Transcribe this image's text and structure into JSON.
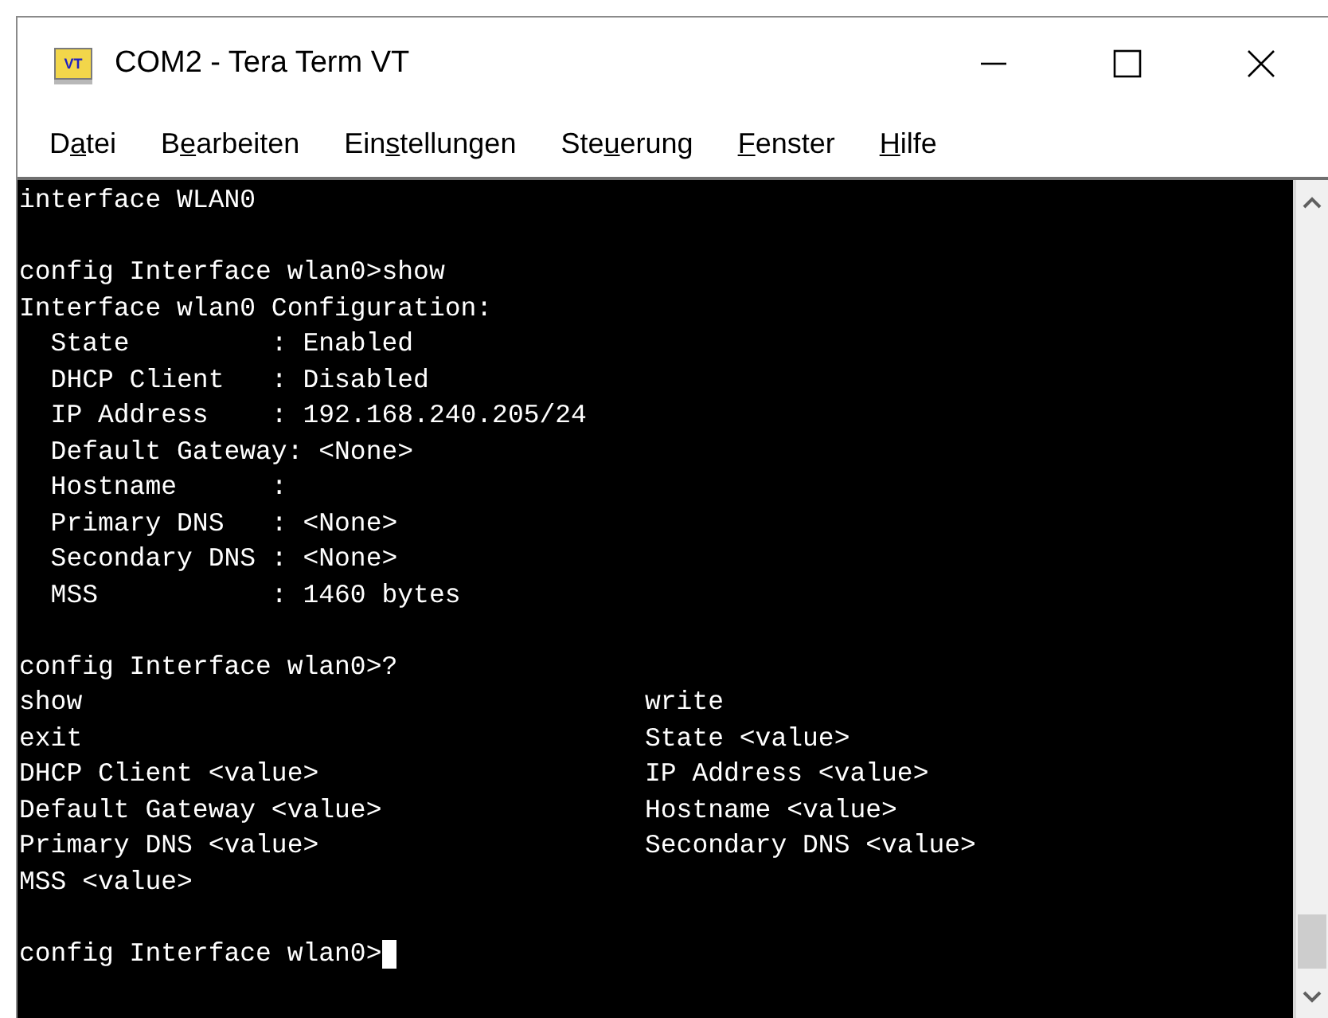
{
  "window": {
    "title": "COM2 - Tera Term VT",
    "app_icon_text": "VT"
  },
  "menu": [
    {
      "pre": "D",
      "key": "a",
      "post": "tei"
    },
    {
      "pre": "B",
      "key": "e",
      "post": "arbeiten"
    },
    {
      "pre": "Ein",
      "key": "s",
      "post": "tellungen"
    },
    {
      "pre": "Ste",
      "key": "u",
      "post": "erung"
    },
    {
      "key": "F",
      "post": "enster"
    },
    {
      "key": "H",
      "post": "ilfe"
    }
  ],
  "terminal": {
    "blocks": [
      [
        {
          "text": "interface WLAN0"
        }
      ],
      [
        {
          "text": "config Interface wlan0>show"
        },
        {
          "text": "Interface wlan0 Configuration:"
        },
        {
          "text": "  State         : Enabled"
        },
        {
          "text": "  DHCP Client   : Disabled"
        },
        {
          "text": "  IP Address    : 192.168.240.205/24"
        },
        {
          "text": "  Default Gateway: <None>"
        },
        {
          "text": "  Hostname      :"
        },
        {
          "text": "  Primary DNS   : <None>"
        },
        {
          "text": "  Secondary DNS : <None>"
        },
        {
          "text": "  MSS           : 1460 bytes"
        }
      ],
      [
        {
          "text": "config Interface wlan0>?"
        },
        {
          "text": "show",
          "right": "write"
        },
        {
          "text": "exit",
          "right": "State <value>"
        },
        {
          "text": "DHCP Client <value>",
          "right": "IP Address <value>"
        },
        {
          "text": "Default Gateway <value>",
          "right": "Hostname <value>"
        },
        {
          "text": "Primary DNS <value>",
          "right": "Secondary DNS <value>"
        },
        {
          "text": "MSS <value>"
        }
      ],
      [
        {
          "text": "config Interface wlan0>",
          "cursor": true
        }
      ]
    ]
  }
}
